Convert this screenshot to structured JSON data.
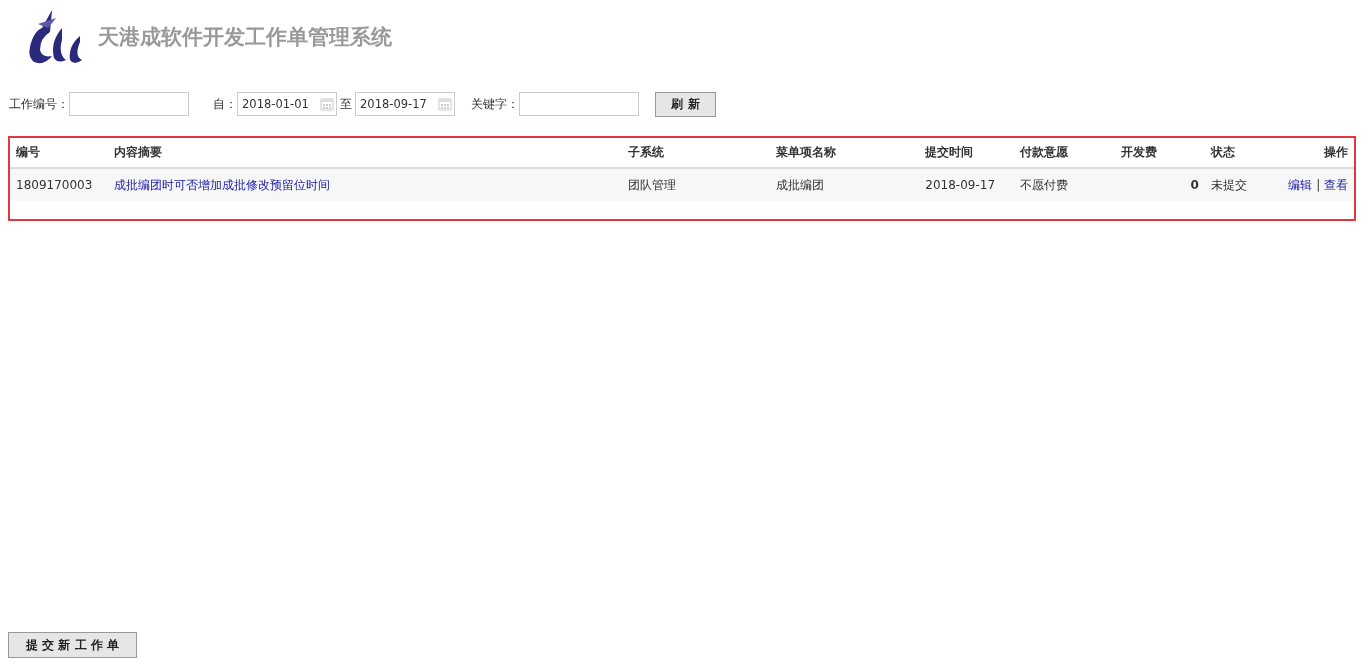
{
  "header": {
    "title": "天港成软件开发工作单管理系统"
  },
  "filters": {
    "work_no_label": "工作编号：",
    "from_label": "自：",
    "from_date": "2018-01-01",
    "to_label": "至",
    "to_date": "2018-09-17",
    "keyword_label": "关键字：",
    "refresh_button": "刷 新"
  },
  "table": {
    "columns": [
      "编号",
      "内容摘要",
      "子系统",
      "菜单项名称",
      "提交时间",
      "付款意愿",
      "开发费",
      "状态",
      "操作"
    ],
    "rows": [
      {
        "id": "1809170003",
        "summary": "成批编团时可否增加成批修改预留位时间",
        "subsystem": "团队管理",
        "menu_item": "成批编团",
        "submitted": "2018-09-17",
        "payment_intent": "不愿付费",
        "fee": "0",
        "status": "未提交",
        "actions": [
          "编辑",
          "查看"
        ],
        "action_separator": "|"
      }
    ]
  },
  "submit_button": "提 交 新 工 作 单"
}
